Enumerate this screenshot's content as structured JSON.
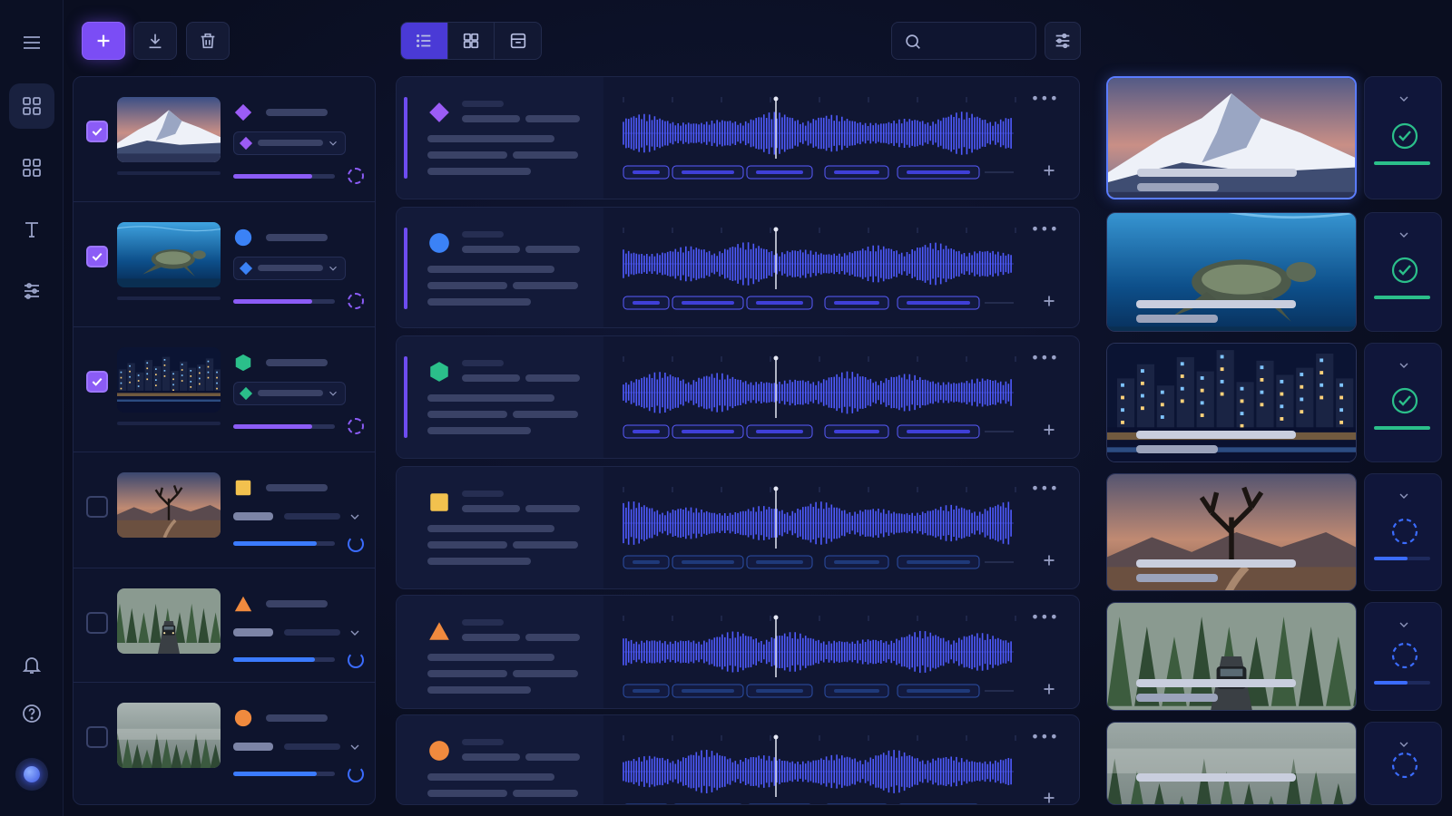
{
  "rail": {
    "icons": [
      "menu-icon",
      "grid-icon",
      "grid-outline-icon",
      "text-icon",
      "sliders-icon",
      "bell-icon",
      "help-icon"
    ]
  },
  "toolbar": {
    "icons": [
      "plus-icon",
      "download-icon",
      "trash-icon"
    ],
    "views": [
      "list-view-icon",
      "grid-view-icon",
      "timeline-view-icon"
    ],
    "search": {
      "value": "",
      "placeholder": ""
    },
    "filter_icon": "filter-icon"
  },
  "colors": {
    "accent": "#7b4df5",
    "selected_view": "#4a3ad6",
    "waveform": "#4f5bff",
    "success": "#2bbf8a",
    "pending": "#3b6cff"
  },
  "items": [
    {
      "checked": true,
      "shape": "diamond",
      "shape_color": "#9b5cf6",
      "scene": "mountain",
      "progress": 0.78,
      "status": "done"
    },
    {
      "checked": true,
      "shape": "circle",
      "shape_color": "#3b82f6",
      "scene": "turtle",
      "progress": 0.78,
      "status": "done"
    },
    {
      "checked": true,
      "shape": "hexagon",
      "shape_color": "#2bbf8a",
      "scene": "city",
      "progress": 0.78,
      "status": "done"
    },
    {
      "checked": false,
      "shape": "square",
      "shape_color": "#f2c14e",
      "scene": "desert",
      "progress": 0.82,
      "status": "pending"
    },
    {
      "checked": false,
      "shape": "triangle",
      "shape_color": "#f08a3e",
      "scene": "forest-road",
      "progress": 0.8,
      "status": "pending"
    },
    {
      "checked": false,
      "shape": "circle",
      "shape_color": "#f08a3e",
      "scene": "foggy-forest",
      "progress": 0.82,
      "status": "pending"
    }
  ]
}
